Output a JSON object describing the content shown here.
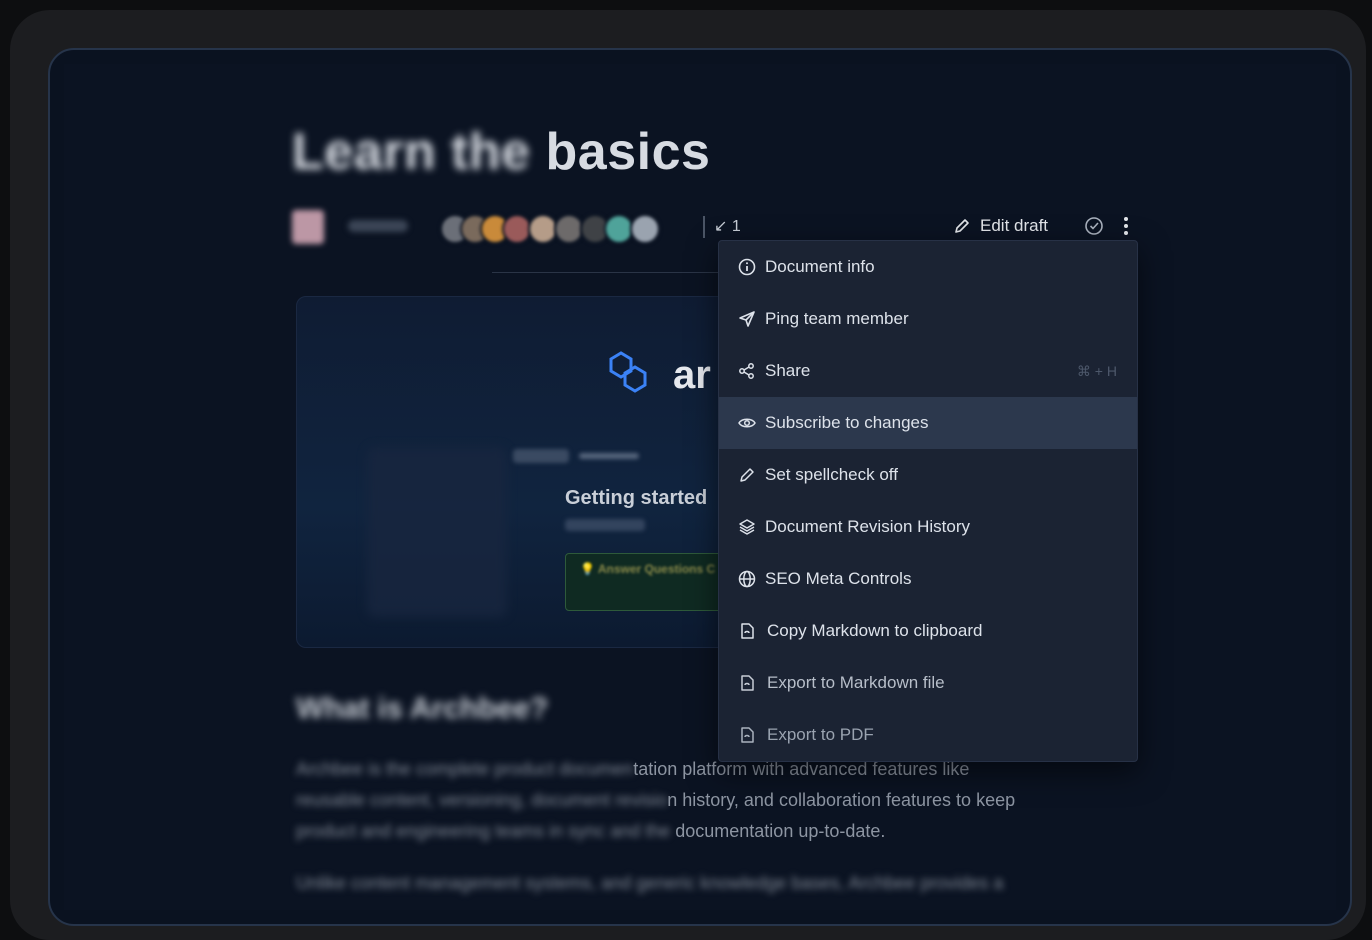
{
  "page": {
    "title_blurred": "Learn the",
    "title": "basics",
    "version_label": "1",
    "edit_draft_label": "Edit draft"
  },
  "cover": {
    "brand": "ar",
    "subtitle": "Getting started",
    "callout": "💡 Answer Questions C"
  },
  "content": {
    "heading": "What is Archbee?",
    "para1_blurred": "Archbee is the complete product documen",
    "para1_visible": "tation platform with advanced features like",
    "para1_line2_blurred": "reusable content, versioning, document revisio",
    "para1_line2_visible": "n history, and collaboration features to keep",
    "para1_line3_blurred": "product and engineering teams in sync and the ",
    "para1_line3_visible": "documentation up-to-date.",
    "para2_blurred": "Unlike content management systems, and generic knowledge bases, Archbee provides a"
  },
  "menu": {
    "items": [
      {
        "label": "Document info",
        "icon": "info-icon"
      },
      {
        "label": "Ping team member",
        "icon": "send-icon"
      },
      {
        "label": "Share",
        "icon": "share-icon",
        "shortcut": "⌘ + H"
      },
      {
        "label": "Subscribe to changes",
        "icon": "eye-icon"
      },
      {
        "label": "Set spellcheck off",
        "icon": "pencil-icon"
      },
      {
        "label": "Document Revision History",
        "icon": "layers-icon"
      },
      {
        "label": "SEO Meta Controls",
        "icon": "globe-icon"
      },
      {
        "label": "Copy Markdown to clipboard",
        "icon": "markdown-icon"
      },
      {
        "label": "Export to Markdown file",
        "icon": "markdown-icon"
      },
      {
        "label": "Export to PDF",
        "icon": "markdown-icon"
      }
    ],
    "highlighted_index": 3
  },
  "colors": {
    "background": "#0b1322",
    "menu_bg": "#1b2333",
    "menu_highlight": "#2c384d",
    "accent_blue": "#3b82f6"
  }
}
